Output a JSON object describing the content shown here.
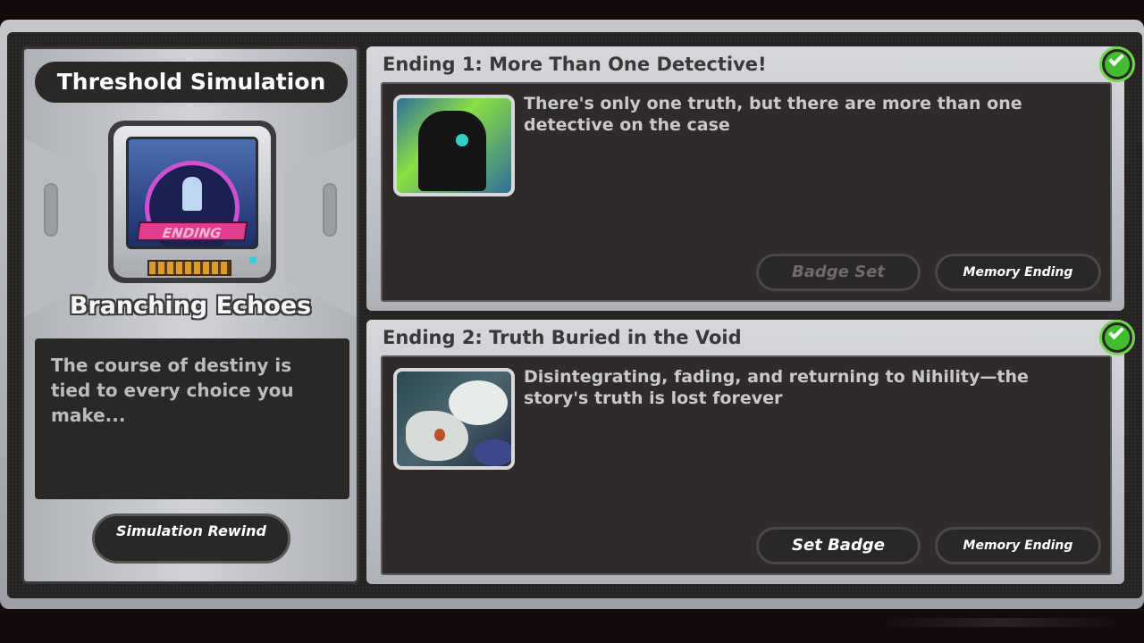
{
  "left_panel": {
    "title": "Threshold Simulation",
    "chip_label": "ENDING",
    "name": "Branching Echoes",
    "description": "The course of destiny is tied to every choice you make...",
    "rewind_button": "Simulation Rewind"
  },
  "endings": [
    {
      "title": "Ending 1: More Than One Detective!",
      "text": "There's only one truth, but there are more than one detective on the case",
      "badge_button": "Badge Set",
      "badge_state": "disabled",
      "memory_button": "Memory Ending",
      "completed": true
    },
    {
      "title": "Ending 2: Truth Buried in the Void",
      "text": "Disintegrating, fading, and returning to Nihility—the story's truth is lost forever",
      "badge_button": "Set Badge",
      "badge_state": "active",
      "memory_button": "Memory Ending",
      "completed": true
    }
  ],
  "icons": {
    "completed": "check-circle-icon",
    "chip": "ending-chip-icon"
  },
  "colors": {
    "check_green": "#3fbf2a",
    "chip_pink": "#e43c8c"
  }
}
